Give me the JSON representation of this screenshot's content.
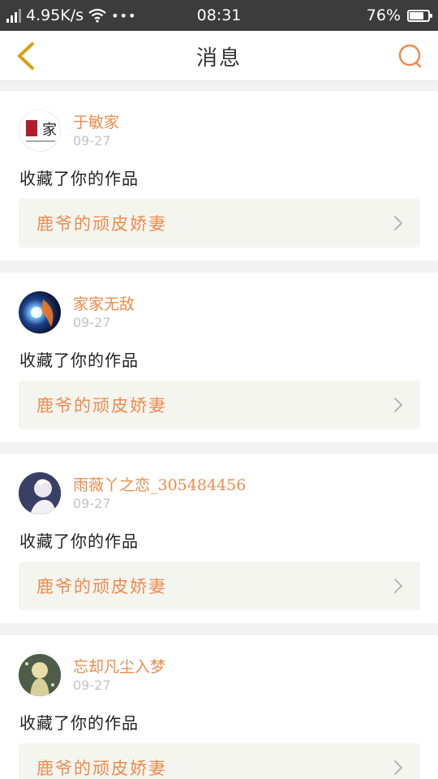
{
  "statusbar": {
    "speed": "4.95K/s",
    "more": "•••",
    "time": "08:31",
    "battery": "76%",
    "battery_level": 0.76
  },
  "nav": {
    "title": "消息",
    "back_icon": "chevron-left-icon",
    "search_icon": "search-icon",
    "accent": "#f08a4b",
    "back_color": "#e8b422"
  },
  "messages": [
    {
      "avatar_text": "家",
      "username": "于敏家",
      "date": "09-27",
      "action": "收藏了你的作品",
      "work": "鹿爷的顽皮娇妻"
    },
    {
      "avatar_text": "",
      "username": "家家无敌",
      "date": "09-27",
      "action": "收藏了你的作品",
      "work": "鹿爷的顽皮娇妻"
    },
    {
      "avatar_text": "",
      "username": "雨薇丫之恋_305484456",
      "date": "09-27",
      "action": "收藏了你的作品",
      "work": "鹿爷的顽皮娇妻"
    },
    {
      "avatar_text": "",
      "username": "忘却凡尘入梦",
      "date": "09-27",
      "action": "收藏了你的作品",
      "work": "鹿爷的顽皮娇妻"
    }
  ]
}
